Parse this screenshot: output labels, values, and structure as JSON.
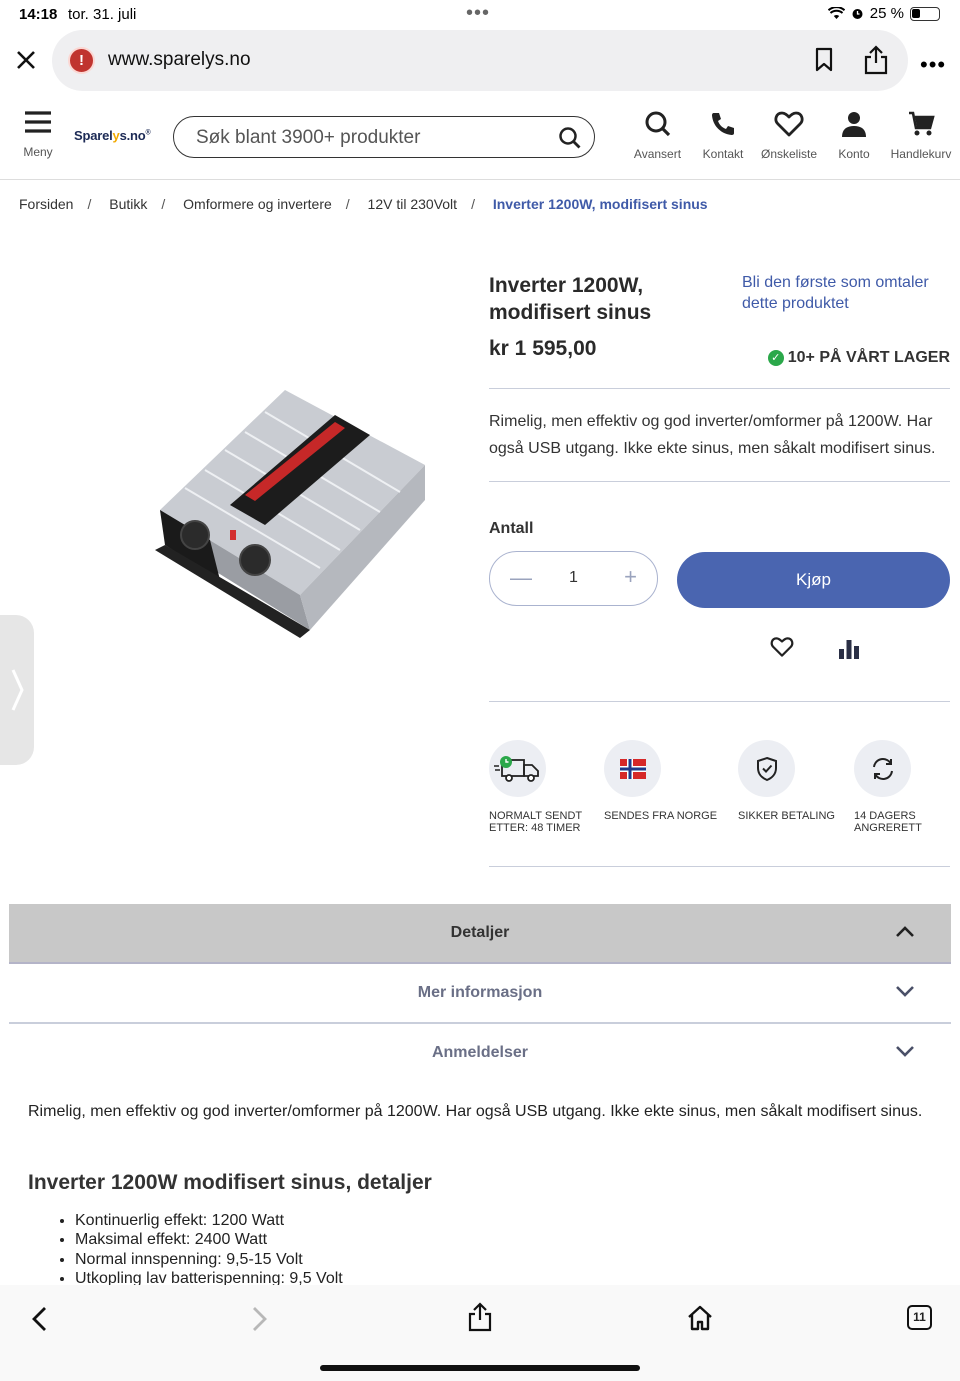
{
  "status": {
    "time": "14:18",
    "date": "tor. 31. juli",
    "battery": "25 %",
    "battery_level": 0.25
  },
  "browser": {
    "url": "www.sparelys.no",
    "warning_glyph": "!"
  },
  "header": {
    "menu_label": "Meny",
    "logo_text_a": "Sparel",
    "logo_text_b": "y",
    "logo_text_c": "s.no",
    "search_placeholder": "Søk blant 3900+ produkter",
    "nav": [
      "Avansert",
      "Kontakt",
      "Ønskeliste",
      "Konto",
      "Handlekurv"
    ]
  },
  "breadcrumb": [
    "Forsiden",
    "Butikk",
    "Omformere og invertere",
    "12V til 230Volt",
    "Inverter 1200W, modifisert sinus"
  ],
  "product": {
    "title": "Inverter 1200W, modifisert sinus",
    "review_link": "Bli den første som omtaler dette produktet",
    "price": "kr 1 595,00",
    "stock": "10+ PÅ VÅRT LAGER",
    "description": "Rimelig, men effektiv og god inverter/omformer på 1200W. Har også USB utgang. Ikke ekte sinus, men såkalt modifisert sinus.",
    "quantity_label": "Antall",
    "quantity": "1",
    "buy_label": "Kjøp"
  },
  "usps": [
    {
      "label": "NORMALT SENDT ETTER: 48 TIMER",
      "icon": "delivery-truck-icon"
    },
    {
      "label": "SENDES FRA NORGE",
      "icon": "norway-flag-icon"
    },
    {
      "label": "SIKKER BETALING",
      "icon": "shield-check-icon"
    },
    {
      "label": "14 DAGERS ANGRERETT",
      "icon": "refresh-icon"
    }
  ],
  "tabs": [
    {
      "label": "Detaljer",
      "open": true
    },
    {
      "label": "Mer informasjon",
      "open": false
    },
    {
      "label": "Anmeldelser",
      "open": false
    }
  ],
  "details": {
    "intro": "Rimelig, men effektiv og god inverter/omformer på 1200W. Har også USB utgang. Ikke ekte sinus, men såkalt modifisert sinus.",
    "heading": "Inverter 1200W modifisert sinus, detaljer",
    "bullets": [
      "Kontinuerlig effekt: 1200 Watt",
      "Maksimal effekt: 2400 Watt",
      "Normal innspenning: 9,5-15 Volt",
      "Utkopling lav batterispenning: 9,5 Volt"
    ]
  },
  "toolbar": {
    "tab_count": "11"
  },
  "colors": {
    "accent": "#4a65b0",
    "link": "#3f5aa8",
    "stock_ok": "#2ba84a"
  }
}
